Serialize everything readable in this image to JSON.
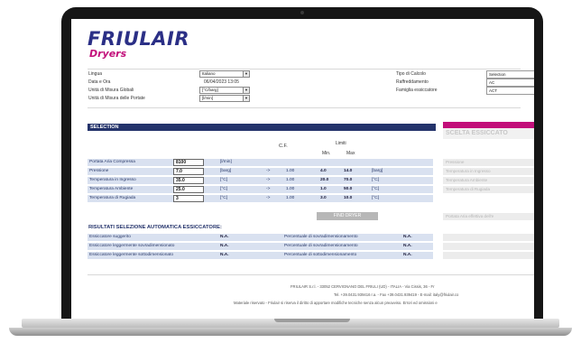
{
  "app": {
    "logo_main": "FRIULAIR",
    "logo_sub": "Dryers"
  },
  "top_fields": {
    "lingua": {
      "label": "Lingua",
      "value": "Italiano"
    },
    "data_ora": {
      "label": "Data e Ora",
      "value": "06/04/2023 13:05"
    },
    "unita_globali": {
      "label": "Unità di Misura Globali",
      "value": "[°C/barg]"
    },
    "unita_portate": {
      "label": "Unità di Misura delle Portate",
      "value": "[l/min]"
    },
    "tipo_calcolo": {
      "label": "Tipo di Calcolo",
      "value": "Selection"
    },
    "raffreddamento": {
      "label": "Raffreddamento",
      "value": "AC"
    },
    "famiglia": {
      "label": "Famiglia essiccatore",
      "value": "ACT"
    }
  },
  "selection": {
    "title": "SELECTION",
    "cf_header": "C.F.",
    "limits_header": "Limiti",
    "min_header": "Min.",
    "max_header": "Max",
    "rows": [
      {
        "label": "Portata Aria Compressa",
        "value": "8100",
        "unit": "[l/min]",
        "arrow": "",
        "cf": "",
        "min": "",
        "max": "",
        "unit2": ""
      },
      {
        "label": "Pressione",
        "value": "7.0",
        "unit": "[barg]",
        "arrow": "->",
        "cf": "1.00",
        "min": "4.0",
        "max": "14.0",
        "unit2": "[barg]"
      },
      {
        "label": "Temperatura in Ingresso",
        "value": "35.0",
        "unit": "[°C]",
        "arrow": "->",
        "cf": "1.00",
        "min": "20.0",
        "max": "70.0",
        "unit2": "[°C]"
      },
      {
        "label": "Temperatura Ambiente",
        "value": "25.0",
        "unit": "[°C]",
        "arrow": "->",
        "cf": "1.00",
        "min": "1.0",
        "max": "50.0",
        "unit2": "[°C]"
      },
      {
        "label": "Temperatura di Rugiada",
        "value": "3",
        "unit": "[°C]",
        "arrow": "->",
        "cf": "1.00",
        "min": "3.0",
        "max": "10.0",
        "unit2": "[°C]"
      }
    ],
    "find_button": "FIND DRYER"
  },
  "results": {
    "title": "RISULTATI SELEZIONE AUTOMATICA ESSICCATORE:",
    "rows": [
      {
        "label": "Essiccatore suggerito",
        "value": "N.A.",
        "pct_label": "Percentuale di sovradimensionamento",
        "pct_value": "N.A."
      },
      {
        "label": "Essiccatore leggermente sovradimensionato",
        "value": "N.A.",
        "pct_label": "Percentuale di sovradimensionamento",
        "pct_value": "N.A."
      },
      {
        "label": "Essiccatore leggermente sottodimensionato",
        "value": "N.A.",
        "pct_label": "Percentuale di sottodimensionamento",
        "pct_value": "N.A."
      }
    ]
  },
  "right_panel": {
    "title": "SCELTA ESSICCATO",
    "rows": [
      "Pressione",
      "Temperatura in Ingresso",
      "Temperatura Ambiente",
      "Temperatura di Rugiada"
    ],
    "portata_label": "Portata Aria effettiva dell'e"
  },
  "footer": {
    "line1": "FRIULAIR S.r.l. - 33052 CERVIGNANO DEL FRIULI (UD) - ITALIA - Via Cissis, 36 - Fr",
    "line2": "Tel. +39.0431.939416 r.a. - Fax +39.0431.939419 - E-mail: italy@friulair.co",
    "line3": "Materiale riservato - Friulair si riserva il diritto di apportare modifiche tecniche senza alcun preavviso. Errori ed omissioni e"
  }
}
